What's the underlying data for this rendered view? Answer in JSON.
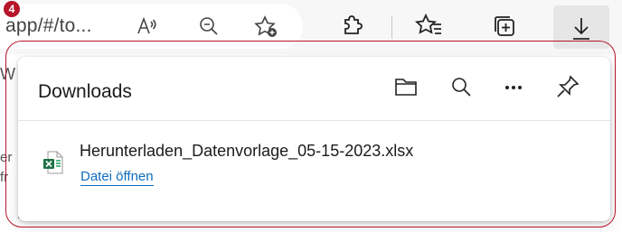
{
  "browser": {
    "url_text": "app/#/to...",
    "badge_number": "4",
    "address_icons": [
      "read-aloud-icon",
      "zoom-out-icon",
      "add-favorite-icon"
    ],
    "toolbar_icons": [
      "extensions-icon",
      "favorites-icon",
      "collections-icon",
      "downloads-icon"
    ]
  },
  "downloads_panel": {
    "title": "Downloads",
    "header_icons": [
      "folder-icon",
      "search-icon",
      "more-options-icon",
      "pin-icon"
    ],
    "items": [
      {
        "file_name": "Herunterladen_Datenvorlage_05-15-2023.xlsx",
        "action_label": "Datei öffnen"
      }
    ]
  },
  "background_text": {
    "line1": "er",
    "line2": "fr"
  },
  "colors": {
    "annotation": "#b7152a",
    "link": "#0f6cbd",
    "excel_green": "#1e7145",
    "toolbar_bg": "#f7f7f7"
  }
}
